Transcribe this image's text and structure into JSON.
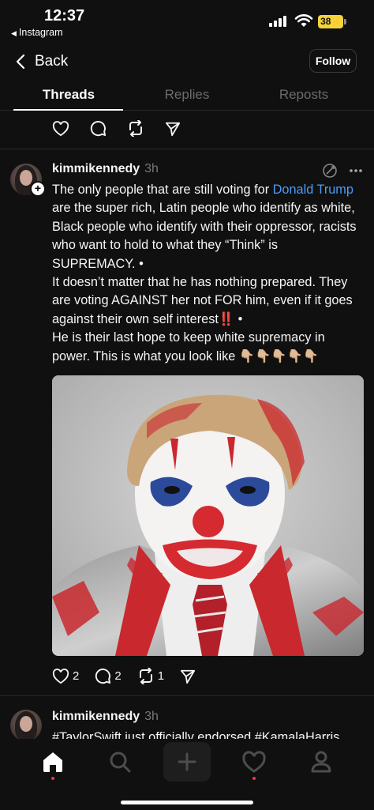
{
  "status": {
    "time": "12:37",
    "back_app": "Instagram",
    "battery": "38"
  },
  "nav": {
    "back_label": "Back",
    "follow_label": "Follow"
  },
  "tabs": [
    {
      "label": "Threads",
      "active": true
    },
    {
      "label": "Replies",
      "active": false
    },
    {
      "label": "Reposts",
      "active": false
    }
  ],
  "post": {
    "username": "kimmikennedy",
    "time": "3h",
    "text_1a": "The only people that are still voting for ",
    "text_1_link": "Donald Trump",
    "text_1b": " are the super rich, Latin people who identify as white, Black people who identify with their oppressor, racists who want to hold to what they “Think” is SUPREMACY. •",
    "text_2": "It doesn’t matter that he has nothing prepared. They are voting AGAINST her not FOR him, even if it goes against their own self interest‼️ •",
    "text_3": "He is their last hope to keep white supremacy in power. This is what you look like 👇🏼👇🏼👇🏼👇🏼👇🏼",
    "likes": "2",
    "comments": "2",
    "reposts": "1"
  },
  "next_post": {
    "username": "kimmikennedy",
    "time": "3h",
    "text_preview": "#TaylorSwift just officially endorsed #KamalaHarris"
  },
  "icons": [
    "heart-icon",
    "comment-icon",
    "repost-icon",
    "share-icon",
    "home-icon",
    "search-icon",
    "plus-icon",
    "activity-icon",
    "profile-icon"
  ],
  "colors": {
    "background": "#101010",
    "link": "#4a9df8",
    "notification_dot": "#ff3040",
    "battery": "#f6d33a"
  }
}
